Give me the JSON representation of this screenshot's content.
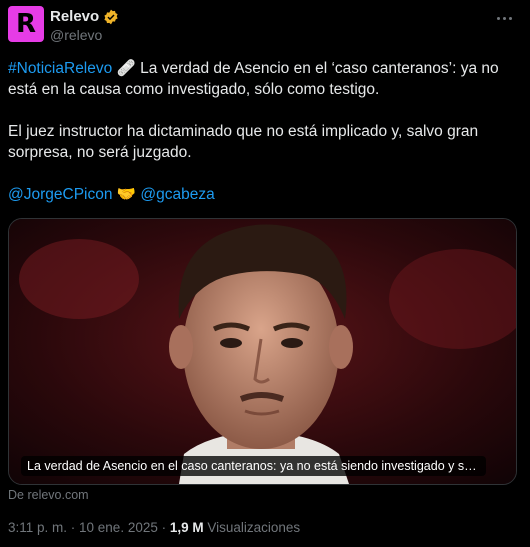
{
  "author": {
    "avatar_letter": "R",
    "name": "Relevo",
    "handle": "@relevo",
    "verified_icon": "verified-badge-icon"
  },
  "tweet": {
    "hashtag": "#NoticiaRelevo",
    "emoji1": "🩹",
    "line1_rest": " La verdad de Asencio en el ‘caso canteranos’: ya no está en la causa como investigado, sólo como testigo.",
    "line2": "El juez instructor ha dictaminado que no está implicado y, salvo gran sorpresa, no será juzgado.",
    "mention1": "@JorgeCPicon",
    "emoji2": "🤝",
    "mention2": "@gcabeza"
  },
  "card": {
    "caption": "La verdad de Asencio en el caso canteranos: ya no está siendo investigado y sólo sigue como testigo",
    "source": "De relevo.com"
  },
  "meta": {
    "time": "3:11 p. m. · 10 ene. 2025 · ",
    "views_count": "1,9 M",
    "views_label": " Visualizaciones"
  },
  "colors": {
    "accent": "#1d9bf0",
    "brand": "#e63ce6",
    "verified": "#f0b429"
  }
}
